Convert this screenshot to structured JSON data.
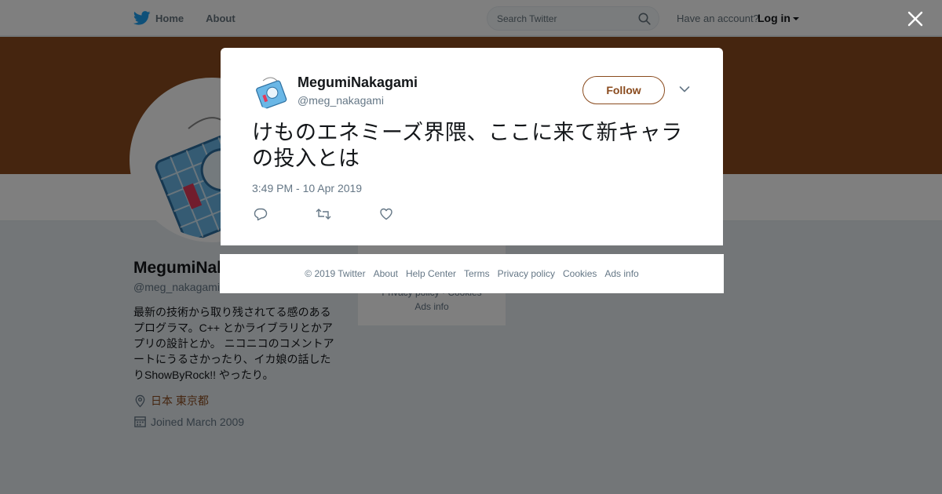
{
  "nav": {
    "home_label": "Home",
    "about_label": "About",
    "search_placeholder": "Search Twitter",
    "account_prompt": "Have an account?",
    "login_label": "Log in"
  },
  "profile": {
    "name": "MegumiNakagami",
    "handle": "@meg_nakagami",
    "bio": "最新の技術から取り残されてる感のあるプログラマ。C++ とかライブラリとかアプリの設計とか。 ニコニコのコメントアートにうるさかったり、イカ娘の話したりShowByRock!! やったり。",
    "location": "日本 東京都",
    "joined": "Joined March 2009",
    "banner_color": "#8a4b1e"
  },
  "side_box": {
    "line1": "Privacy policy · Cookies",
    "line2": "Ads info"
  },
  "tweet": {
    "name": "MegumiNakagami",
    "handle": "@meg_nakagami",
    "follow_label": "Follow",
    "text": "けものエネミーズ界隈、ここに来て新キャラの投入とは",
    "timestamp": "3:49 PM - 10 Apr 2019",
    "accent_color": "#8a4b1e"
  },
  "footer": {
    "copyright": "© 2019 Twitter",
    "links": [
      "About",
      "Help Center",
      "Terms",
      "Privacy policy",
      "Cookies",
      "Ads info"
    ]
  },
  "icons": {
    "brand": "twitter-bird-icon",
    "search": "search-icon",
    "close": "close-icon",
    "reply": "reply-icon",
    "retweet": "retweet-icon",
    "like": "heart-icon",
    "more": "chevron-down-icon",
    "location": "location-pin-icon",
    "calendar": "calendar-icon"
  }
}
